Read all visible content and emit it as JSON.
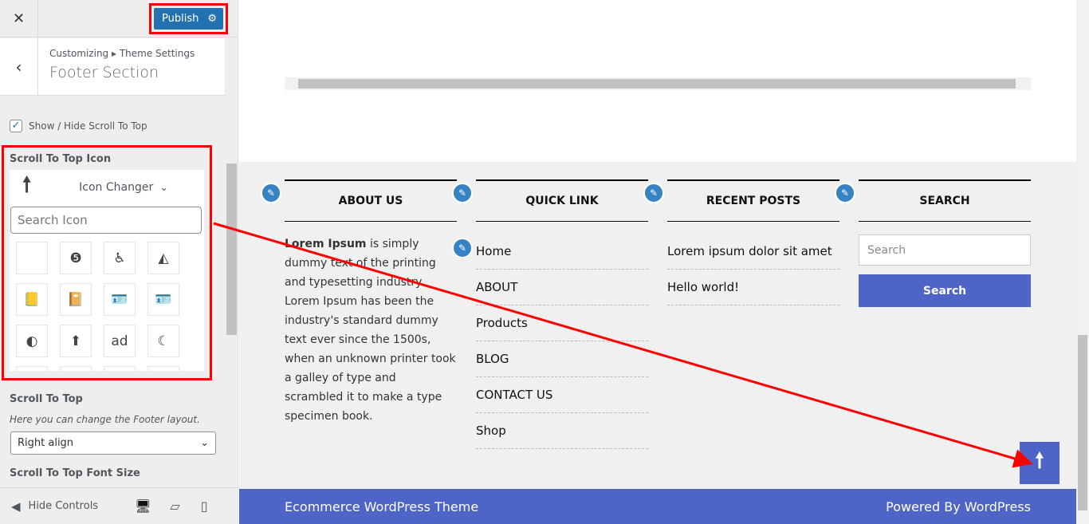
{
  "sidebar": {
    "close": "✕",
    "publish": "Publish",
    "back": "‹",
    "breadcrumb": "Customizing ▸ Theme Settings",
    "title": "Footer Section",
    "show_hide": "Show / Hide Scroll To Top",
    "icon_label": "Scroll To Top Icon",
    "icon_changer": "Icon Changer",
    "search_placeholder": "Search Icon",
    "icons": [
      "",
      "❺",
      "♿",
      "◭",
      "📒",
      "📔",
      "🪪",
      "🪪",
      "◐",
      "⬆",
      "ad",
      "☾"
    ],
    "scroll_to_top": "Scroll To Top",
    "scroll_desc": "Here you can change the Footer layout.",
    "align_value": "Right align",
    "font_size": "Scroll To Top Font Size",
    "hide_controls": "Hide Controls"
  },
  "footer": {
    "about_title": "ABOUT US",
    "about_bold": "Lorem Ipsum",
    "about_text": " is simply dummy text of the printing and typesetting industry. Lorem Ipsum has been the industry's standard dummy text ever since the 1500s, when an unknown printer took a galley of type and scrambled it to make a type specimen book.",
    "quick_title": "QUICK LINK",
    "links": [
      "Home",
      "ABOUT",
      "Products",
      "BLOG",
      "CONTACT US",
      "Shop"
    ],
    "recent_title": "RECENT POSTS",
    "posts": [
      "Lorem ipsum dolor sit amet",
      "Hello world!"
    ],
    "search_title": "SEARCH",
    "search_placeholder": "Search",
    "search_button": "Search",
    "left_text": "Ecommerce WordPress Theme",
    "right_text": "Powered By WordPress"
  },
  "colors": {
    "accent": "#4e64c6",
    "publish": "#2271b1",
    "annotation": "#ff0000"
  }
}
